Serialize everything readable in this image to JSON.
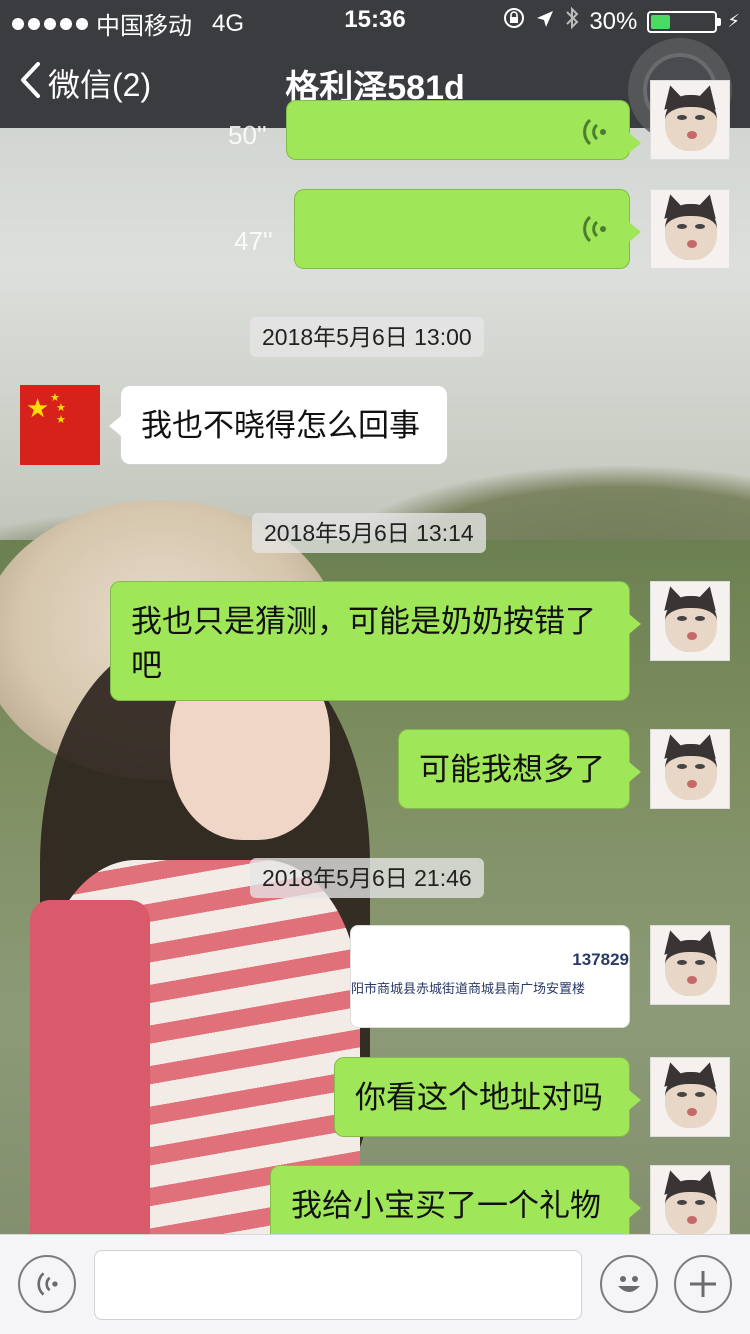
{
  "status_bar": {
    "carrier": "中国移动",
    "network": "4G",
    "time": "15:36",
    "battery": "30%",
    "battery_level": 0.3
  },
  "nav": {
    "back_label": "微信(2)",
    "title": "格利泽581d"
  },
  "chat": {
    "voice_messages": [
      {
        "duration": "50''"
      },
      {
        "duration": "47''"
      }
    ],
    "timestamps": [
      "2018年5月6日 13:00",
      "2018年5月6日 13:14",
      "2018年5月6日 21:46"
    ],
    "messages": [
      {
        "text": "我也不晓得怎么回事"
      },
      {
        "text": "我也只是猜测，可能是奶奶按错了"
      },
      {
        "text_line2": "吧"
      },
      {
        "text": "可能我想多了"
      },
      {
        "text": "你看这个地址对吗"
      },
      {
        "text": "我给小宝买了一个礼物"
      }
    ],
    "image_card": {
      "number": "137829",
      "address": "阳市商城县赤城街道商城县南广场安置楼"
    }
  },
  "colors": {
    "bar_bg": "#3b3c3f",
    "bubble_green": "#9fe658",
    "battery_green": "#4cd964"
  },
  "icons": [
    "back-chevron-icon",
    "more-icon",
    "voice-wave-icon",
    "emoji-icon",
    "plus-icon",
    "location-lock-icon",
    "location-arrow-icon",
    "bluetooth-icon"
  ]
}
